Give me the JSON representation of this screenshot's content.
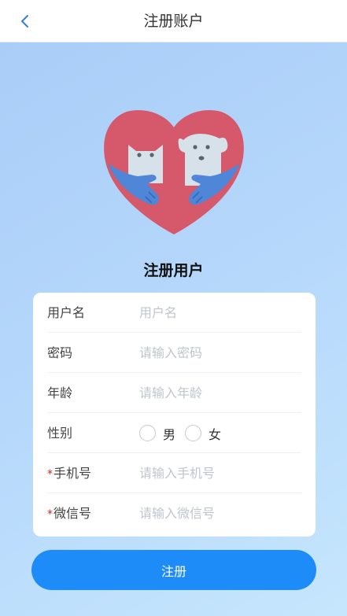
{
  "header": {
    "title": "注册账户",
    "back_icon": "chevron-left-icon"
  },
  "logo": {
    "icon": "pets-heart-logo"
  },
  "form": {
    "title": "注册用户",
    "username": {
      "label": "用户名",
      "placeholder": "用户名"
    },
    "password": {
      "label": "密码",
      "placeholder": "请输入密码"
    },
    "age": {
      "label": "年龄",
      "placeholder": "请输入年龄"
    },
    "gender": {
      "label": "性别",
      "options": [
        "男",
        "女"
      ]
    },
    "phone": {
      "required_mark": "*",
      "label": "手机号",
      "placeholder": "请输入手机号"
    },
    "wechat": {
      "required_mark": "*",
      "label": "微信号",
      "placeholder": "请输入微信号"
    },
    "submit_label": "注册"
  },
  "colors": {
    "accent": "#1e8cf8",
    "heart": "#d5596a",
    "hands": "#4f86d8",
    "required": "#e02020"
  }
}
